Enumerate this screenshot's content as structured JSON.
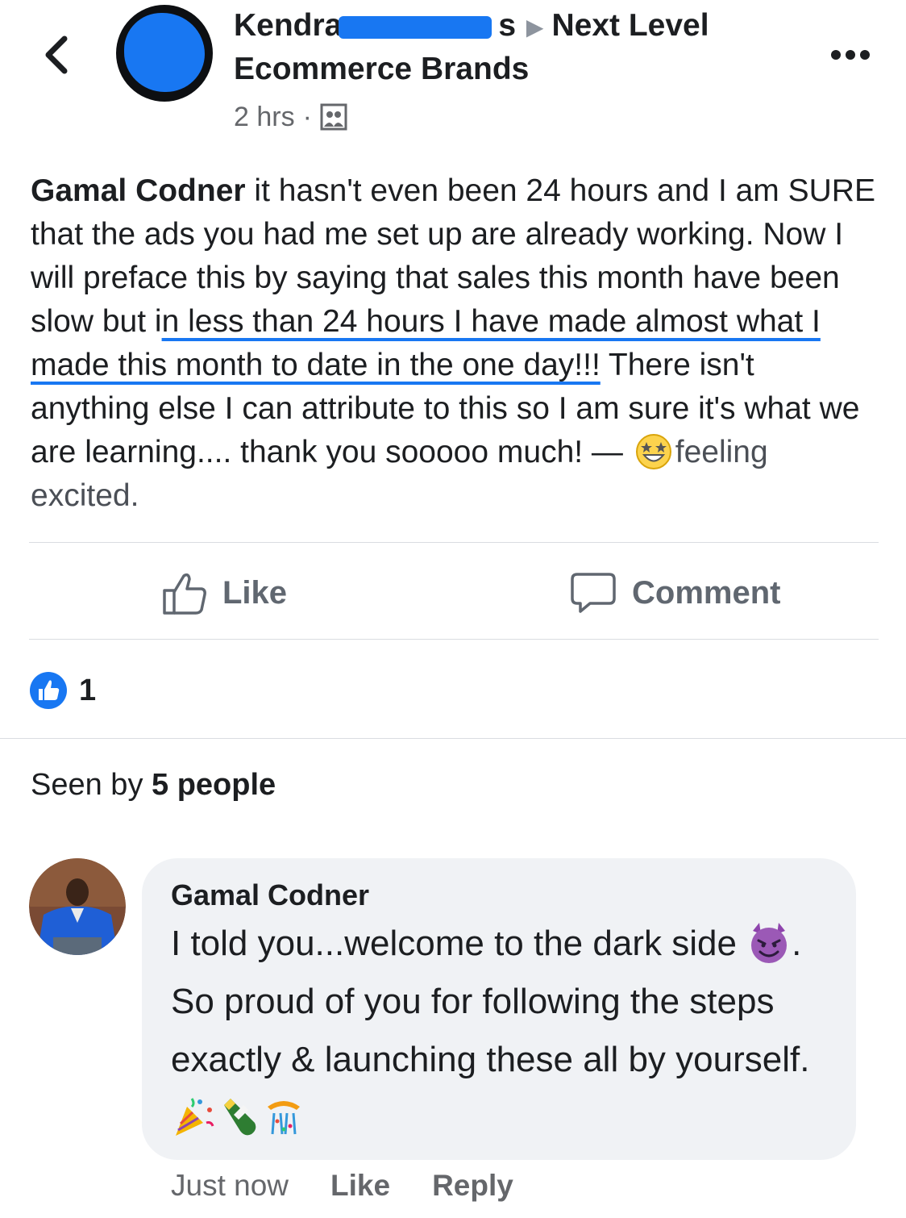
{
  "header": {
    "author_first": "Kendra",
    "redacted_tail": "s",
    "group_line1": "Next Level",
    "group_line2": "Ecommerce Brands",
    "time": "2 hrs",
    "separator": "·"
  },
  "post": {
    "mention": "Gamal Codner",
    "text_before": " it hasn't even been 24 hours and I am SURE that the ads you had me set up are already working.  Now I will preface this by saying that sales this month have been slow but i",
    "highlighted": "n less than 24 hours I have made almost what I made this month to date in the one day!!!",
    "text_after": "  There isn't anything else I can attribute to this so I am sure it's what we are learning.... thank you sooooo much! — ",
    "feeling": "feeling excited."
  },
  "actions": {
    "like_label": "Like",
    "comment_label": "Comment"
  },
  "reactions": {
    "count": "1"
  },
  "seen": {
    "prefix": "Seen by ",
    "count_text": "5 people"
  },
  "comment": {
    "author": "Gamal Codner",
    "text_part1": "I told you...welcome to the dark side ",
    "text_part2": ". So proud of you for following the steps exactly & launching these all by yourself. ",
    "time": "Just now",
    "like_label": "Like",
    "reply_label": "Reply"
  },
  "colors": {
    "facebook_blue": "#1877f2",
    "text_primary": "#1c1e21",
    "text_secondary": "#65676b",
    "bubble_bg": "#f0f2f5",
    "divider": "#dadde1"
  },
  "icons": [
    "back-chevron-icon",
    "group-icon",
    "more-options-icon",
    "grinning-star-eyes-emoji",
    "thumbs-up-icon",
    "comment-icon",
    "like-reaction-icon",
    "smiling-devil-emoji",
    "party-popper-emoji",
    "champagne-emoji",
    "confetti-ball-emoji"
  ]
}
